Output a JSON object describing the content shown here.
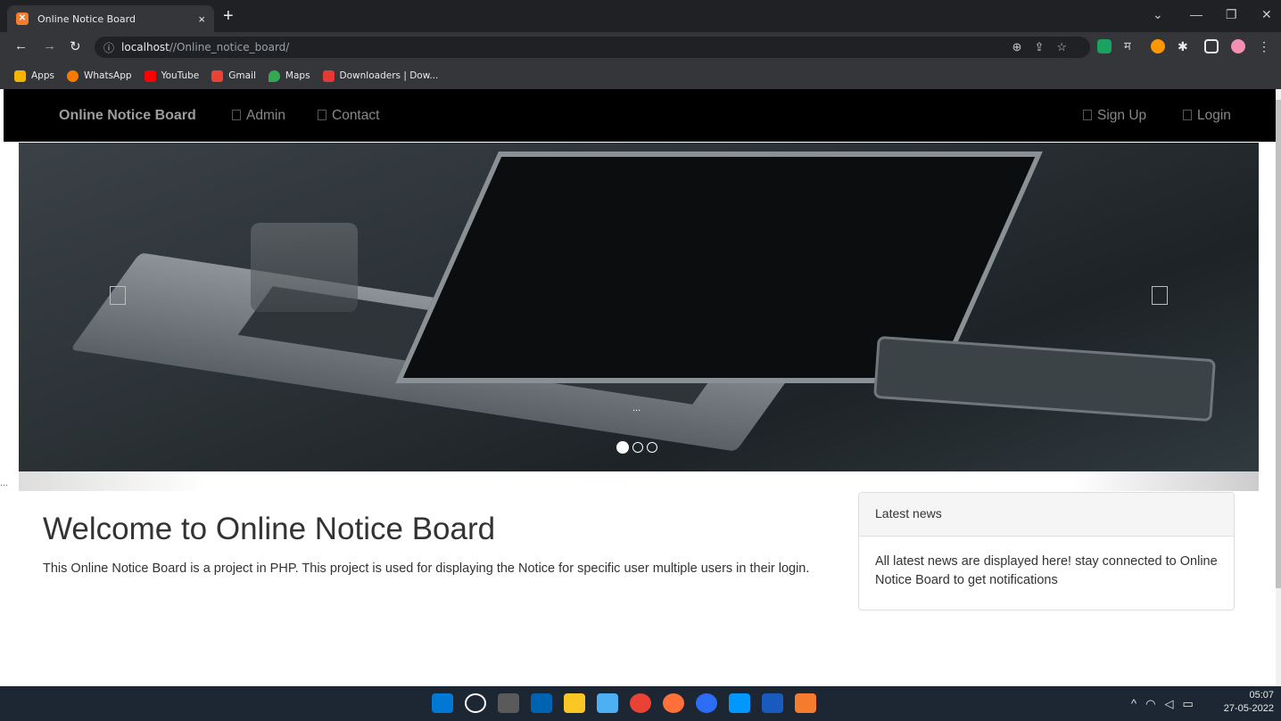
{
  "browser": {
    "tab_title": "Online Notice Board",
    "tab_close": "×",
    "new_tab": "+",
    "url_host": "localhost",
    "url_path": "//Online_notice_board/",
    "bookmarks": [
      {
        "label": "Apps",
        "color": "#f4b400"
      },
      {
        "label": "WhatsApp",
        "color": "#f57c00"
      },
      {
        "label": "YouTube",
        "color": "#ff0000"
      },
      {
        "label": "Gmail",
        "color": "#ea4335"
      },
      {
        "label": "Maps",
        "color": "#34a853"
      },
      {
        "label": "Downloaders | Dow...",
        "color": "#e53935"
      }
    ]
  },
  "site": {
    "brand": "Online Notice Board",
    "nav": {
      "admin": "Admin",
      "contact": "Contact",
      "signup": "Sign Up",
      "login": "Login"
    },
    "carousel": {
      "caption": "...",
      "slide_count": 3,
      "active_slide": 1
    },
    "strip_text": "...",
    "welcome_title": "Welcome to Online Notice Board",
    "intro": "This Online Notice Board is a project in PHP. This project is used for displaying the Notice for specific user multiple users in their login.",
    "news_panel": {
      "heading": "Latest news",
      "body": "All latest news are displayed here! stay connected to Online Notice Board to get notifications"
    }
  },
  "taskbar": {
    "time": "05:07",
    "date": "27-05-2022",
    "app_colors": [
      "#0078d4",
      "#ffffff",
      "#4a4a4a",
      "#0063b1",
      "#f9c623",
      "#4cb0f2",
      "#ea4335",
      "#ff7139",
      "#2d6df6",
      "#0098ff",
      "#185abd",
      "#f47c2c"
    ]
  }
}
